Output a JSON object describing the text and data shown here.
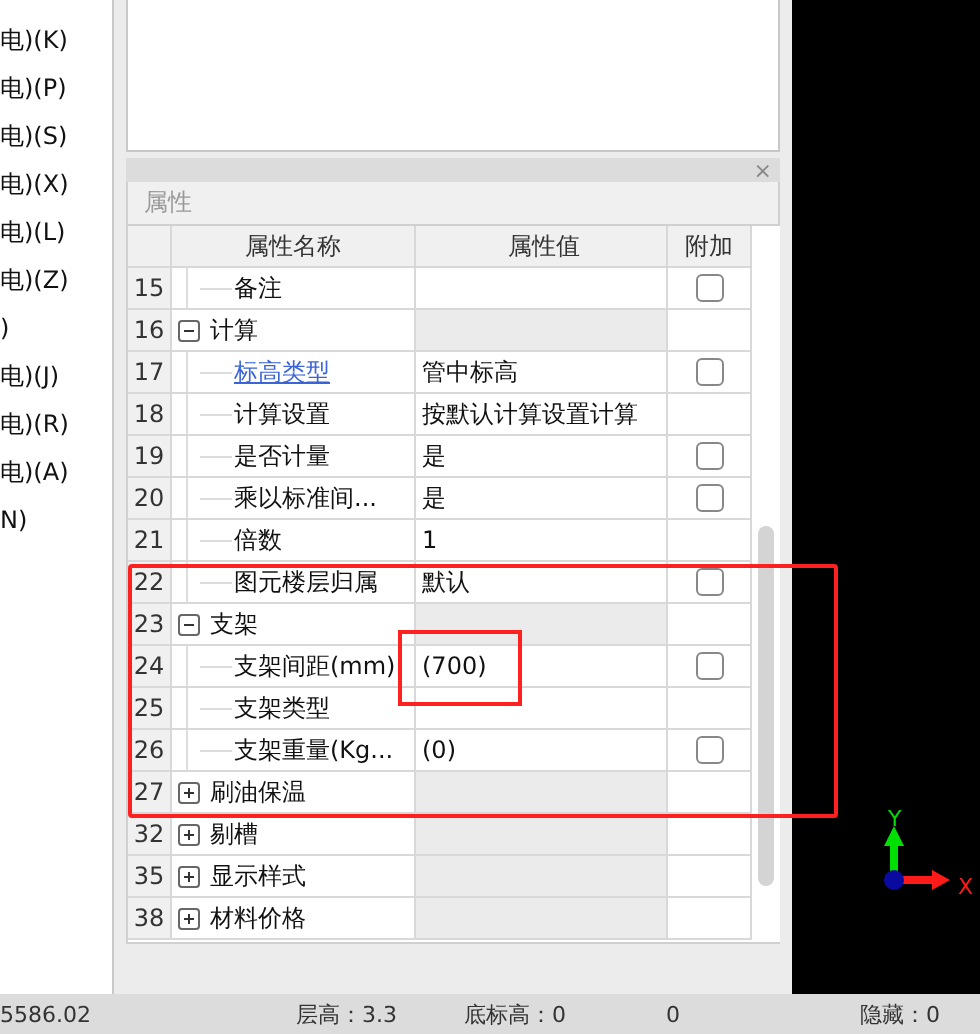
{
  "left_list": {
    "items": [
      "电)(K)",
      "电)(P)",
      "电)(S)",
      "电)(X)",
      "电)(L)",
      "电)(Z)",
      ")",
      "电)(J)",
      "电)(R)",
      "电)(A)",
      "N)"
    ]
  },
  "properties_panel": {
    "close": "×",
    "title": "属性",
    "columns": [
      "属性名称",
      "属性值",
      "附加"
    ],
    "rows": [
      {
        "number": "15",
        "kind": "item",
        "name": "备注",
        "value": "",
        "addable": true,
        "checked": false
      },
      {
        "number": "16",
        "kind": "group",
        "name": "计算",
        "expanded": true
      },
      {
        "number": "17",
        "kind": "item",
        "name": "标高类型",
        "link": true,
        "value": "管中标高",
        "addable": true,
        "checked": false
      },
      {
        "number": "18",
        "kind": "item",
        "name": "计算设置",
        "value": "按默认计算设置计算",
        "addable": false
      },
      {
        "number": "19",
        "kind": "item",
        "name": "是否计量",
        "value": "是",
        "addable": true,
        "checked": false
      },
      {
        "number": "20",
        "kind": "item",
        "name": "乘以标准间...",
        "value": "是",
        "addable": true,
        "checked": false
      },
      {
        "number": "21",
        "kind": "item",
        "name": "倍数",
        "value": "1",
        "addable": false
      },
      {
        "number": "22",
        "kind": "item",
        "name": "图元楼层归属",
        "value": "默认",
        "addable": true,
        "checked": false
      },
      {
        "number": "23",
        "kind": "group",
        "name": "支架",
        "expanded": true
      },
      {
        "number": "24",
        "kind": "item",
        "name": "支架间距(mm)",
        "value": "(700)",
        "addable": true,
        "checked": false
      },
      {
        "number": "25",
        "kind": "item",
        "name": "支架类型",
        "value": "",
        "addable": false
      },
      {
        "number": "26",
        "kind": "item",
        "name": "支架重量(Kg...",
        "value": "(0)",
        "addable": true,
        "checked": false
      },
      {
        "number": "27",
        "kind": "group",
        "name": "刷油保温",
        "expanded": false
      },
      {
        "number": "32",
        "kind": "group",
        "name": "剔槽",
        "expanded": false
      },
      {
        "number": "35",
        "kind": "group",
        "name": "显示样式",
        "expanded": false
      },
      {
        "number": "38",
        "kind": "group",
        "name": "材料价格",
        "expanded": false
      }
    ]
  },
  "axis_gizmo": {
    "y_label": "Y",
    "x_label": "X"
  },
  "status_bar": {
    "items": [
      "5586.02",
      "层高：3.3",
      "底标高：0",
      "0",
      "隐藏：0"
    ]
  }
}
